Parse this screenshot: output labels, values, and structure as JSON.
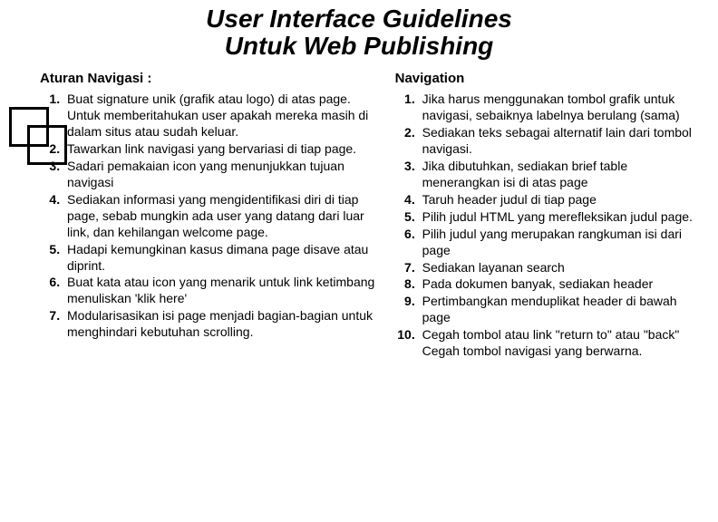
{
  "title": {
    "line1": "User Interface Guidelines",
    "line2": "Untuk Web Publishing"
  },
  "left": {
    "heading": "Aturan Navigasi :",
    "items": [
      "Buat signature unik (grafik atau logo) di atas page. Untuk memberitahukan user apakah mereka masih di dalam situs atau sudah keluar.",
      "Tawarkan link navigasi yang bervariasi di tiap page.",
      "Sadari pemakaian icon yang menunjukkan tujuan navigasi",
      "Sediakan informasi yang mengidentifikasi diri di tiap page, sebab mungkin ada user yang datang dari luar link, dan kehilangan welcome page.",
      "Hadapi kemungkinan kasus dimana page disave atau diprint.",
      "Buat kata atau icon yang menarik untuk link ketimbang menuliskan 'klik here'",
      " Modularisasikan isi page menjadi bagian-bagian untuk menghindari kebutuhan scrolling."
    ]
  },
  "right": {
    "heading": "Navigation",
    "items": [
      "Jika harus menggunakan tombol grafik untuk navigasi, sebaiknya labelnya berulang (sama)",
      "Sediakan teks sebagai alternatif lain dari tombol navigasi.",
      "Jika dibutuhkan, sediakan brief table menerangkan isi di atas page",
      "Taruh header judul di tiap page",
      "Pilih judul HTML yang merefleksikan judul page.",
      "Pilih judul yang merupakan rangkuman isi dari page",
      "Sediakan layanan search",
      "Pada dokumen banyak, sediakan header",
      "Pertimbangkan menduplikat header di bawah page",
      "Cegah tombol atau link \"return to\" atau \"back\" Cegah tombol navigasi yang berwarna."
    ]
  }
}
